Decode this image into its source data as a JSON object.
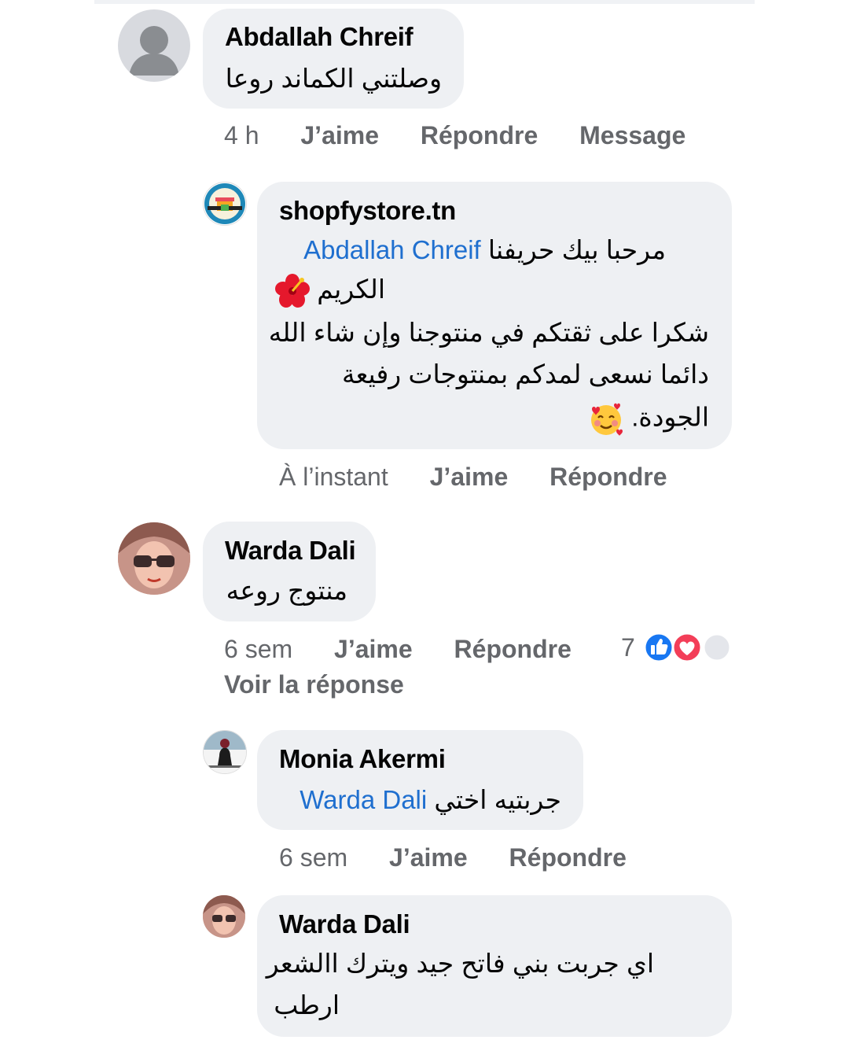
{
  "colors": {
    "bubble": "#eef0f3",
    "meta_text": "#65676b",
    "mention": "#1f6fcf",
    "like_blue": "#1877f2",
    "love_red": "#f33e58"
  },
  "comments": [
    {
      "author": "Abdallah Chreif",
      "text": "وصلتني الكماند روعا",
      "time": "4 h",
      "like": "J’aime",
      "reply": "Répondre",
      "message": "Message",
      "avatar_icon": "default-user-icon"
    },
    {
      "author": "shopfystore.tn",
      "mention": "Abdallah Chreif",
      "line1": "مرحبا بيك حريفنا",
      "line2": "الكريم",
      "line3": "شكرا على ثقتكم في منتوجنا وإن شاء الله",
      "line4": "دائما نسعى لمدكم بمنتوجات رفيعة",
      "line5": "الجودة.",
      "time": "À l’instant",
      "like": "J’aime",
      "reply": "Répondre",
      "emoji1": "hibiscus-icon",
      "emoji2": "smiling-face-with-hearts-icon"
    },
    {
      "author": "Warda Dali",
      "text": "منتوج روعه",
      "time": "6 sem",
      "like": "J’aime",
      "reply": "Répondre",
      "reaction_count": "7",
      "view_replies": "Voir la réponse"
    },
    {
      "author": "Monia Akermi",
      "mention": "Warda Dali",
      "text": "جربتيه اختي",
      "time": "6 sem",
      "like": "J’aime",
      "reply": "Répondre"
    },
    {
      "author": "Warda Dali",
      "line1": "اي جربت بني فاتح جيد ويترك االشعر",
      "line2": "ارطب"
    }
  ]
}
